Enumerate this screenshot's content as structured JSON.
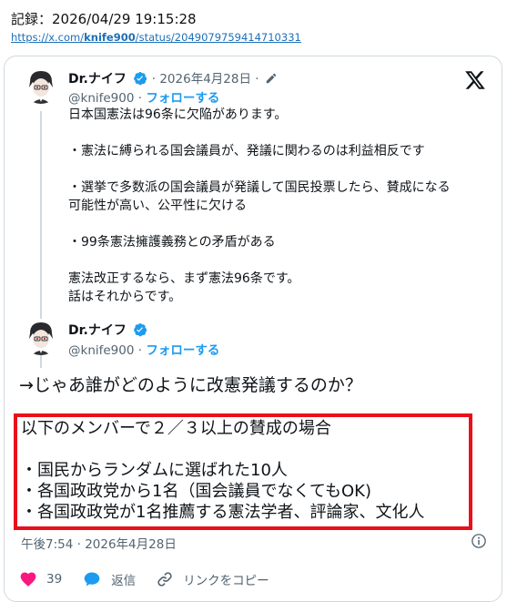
{
  "header": {
    "record": "記録：2026/04/29 19:15:28",
    "url_prefix": "https://x.com/",
    "url_bold": "knife900",
    "url_suffix": "/status/2049079759414710331"
  },
  "tweet1": {
    "name": "Dr.ナイフ",
    "date": "· 2026年4月28日 ·",
    "handle": "@knife900",
    "follow": "フォローする",
    "lines": [
      "日本国憲法は96条に欠陥があります。",
      "",
      "・憲法に縛られる国会議員が、発議に関わるのは利益相反です",
      "",
      "・選挙で多数派の国会議員が発議して国民投票したら、賛成になる",
      "可能性が高い、公平性に欠ける",
      "",
      "・99条憲法擁護義務との矛盾がある",
      "",
      "憲法改正するなら、まず憲法96条です。",
      "話はそれからです。"
    ]
  },
  "tweet2": {
    "name": "Dr.ナイフ",
    "handle": "@knife900",
    "follow": "フォローする",
    "intro": "→じゃあ誰がどのように改憲発議するのか？",
    "box_lines": [
      "以下のメンバーで２／３以上の賛成の場合",
      "",
      "・国民からランダムに選ばれた10人",
      "・各国政政党から1名（国会議員でなくてもOK)",
      "・各国政政党が1名推薦する憲法学者、評論家、文化人"
    ],
    "timestamp": "午後7:54 · 2026年4月28日"
  },
  "actions": {
    "likes": "39",
    "reply": "返信",
    "copy_link": "リンクをコピー"
  },
  "colors": {
    "accent": "#1d9bf0",
    "highlight": "#e8101a",
    "like": "#f91880"
  }
}
